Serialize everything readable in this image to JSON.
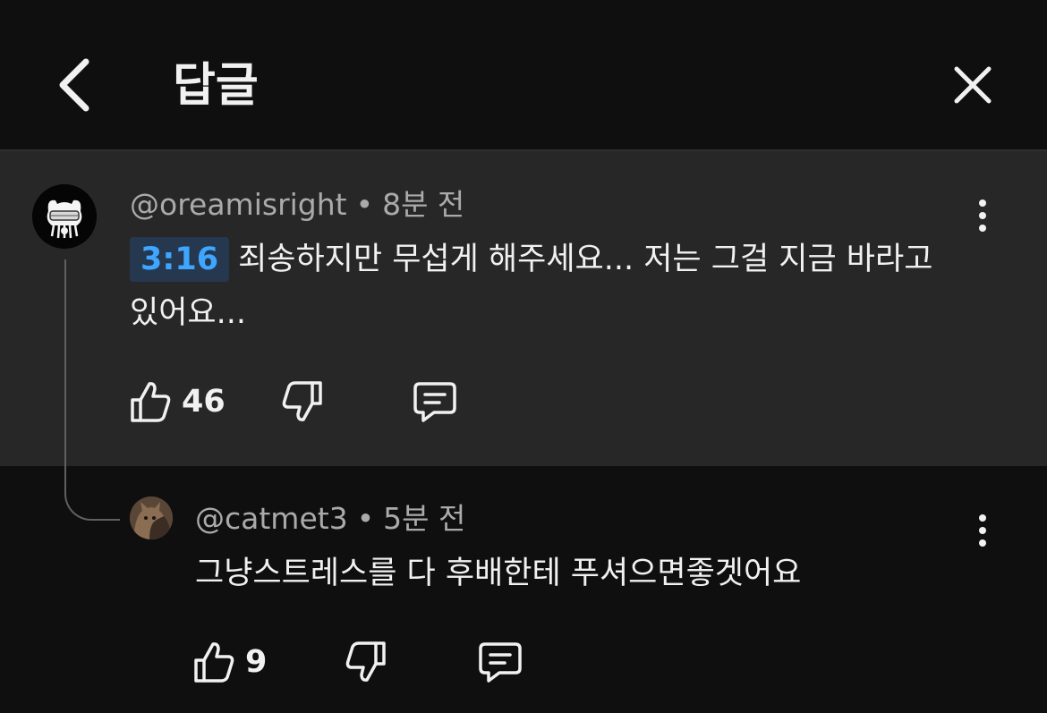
{
  "header": {
    "title": "답글"
  },
  "parent_comment": {
    "author": "@oreamisright",
    "separator": "•",
    "time": "8분 전",
    "timestamp_link": "3:16",
    "text": "죄송하지만 무섭게 해주세요... 저는 그걸 지금 바라고 있어요...",
    "like_count": "46"
  },
  "reply": {
    "author": "@catmet3",
    "separator": "•",
    "time": "5분 전",
    "text": "그냥스트레스를 다 후배한테 푸셔으면좋겟어요",
    "like_count": "9"
  },
  "colors": {
    "background": "#0f0f0f",
    "highlight_background": "#272727",
    "link_blue": "#3ea6ff",
    "secondary_text": "#aaaaaa"
  },
  "icons": {
    "back": "chevron-left-icon",
    "close": "close-icon",
    "like": "thumbs-up-icon",
    "dislike": "thumbs-down-icon",
    "reply": "comment-icon",
    "more": "more-vertical-icon"
  }
}
